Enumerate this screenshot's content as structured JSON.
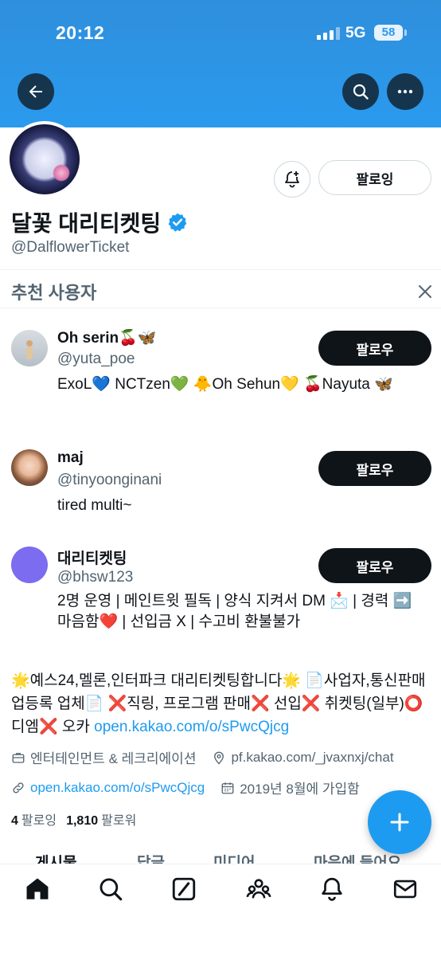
{
  "status_bar": {
    "time": "20:12",
    "network": "5G",
    "battery": "58"
  },
  "profile": {
    "display_name": "달꽃 대리티켓팅",
    "handle": "@DalflowerTicket",
    "following_button": "팔로잉",
    "verified": true,
    "accent_color": "#1d9bf0",
    "banner_color": "#2a9aee"
  },
  "recommendations": {
    "title": "추천 사용자",
    "follow_label": "팔로우",
    "users": [
      {
        "name": "Oh serin🍒🦋",
        "handle": "@yuta_poe",
        "bio": "ExoL💙 NCTzen💚 🐥Oh Sehun💛 🍒Nayuta 🦋"
      },
      {
        "name": "maj",
        "handle": "@tinyoonginani",
        "bio": "tired multi~"
      },
      {
        "name": "대리티켓팅",
        "handle": "@bhsw123",
        "bio": "2명 운영 | 메인트윗 필독 | 양식 지켜서 DM 📩 | 경력 ➡️ 마음함❤️ | 선입금 X | 수고비 환불불가"
      }
    ]
  },
  "bio": {
    "text": "🌟예스24,멜론,인터파크 대리티켓팅합니다🌟 📄사업자,통신판매업등록 업체📄 ❌직링, 프로그램 판매❌ 선입❌ 취켓팅(일부)⭕ 디엠❌ 오카 ",
    "link": "open.kakao.com/o/sPwcQjcg"
  },
  "meta": {
    "category": "엔터테인먼트 & 레크리에이션",
    "location_link": "pf.kakao.com/_jvaxnxj/chat",
    "website": "open.kakao.com/o/sPwcQjcg",
    "joined": "2019년 8월에 가입함"
  },
  "counts": {
    "following_num": "4",
    "following_label": "팔로잉",
    "followers_num": "1,810",
    "followers_label": "팔로워"
  },
  "tabs": [
    "게시물",
    "답글",
    "미디어",
    "마음에 들어요"
  ]
}
